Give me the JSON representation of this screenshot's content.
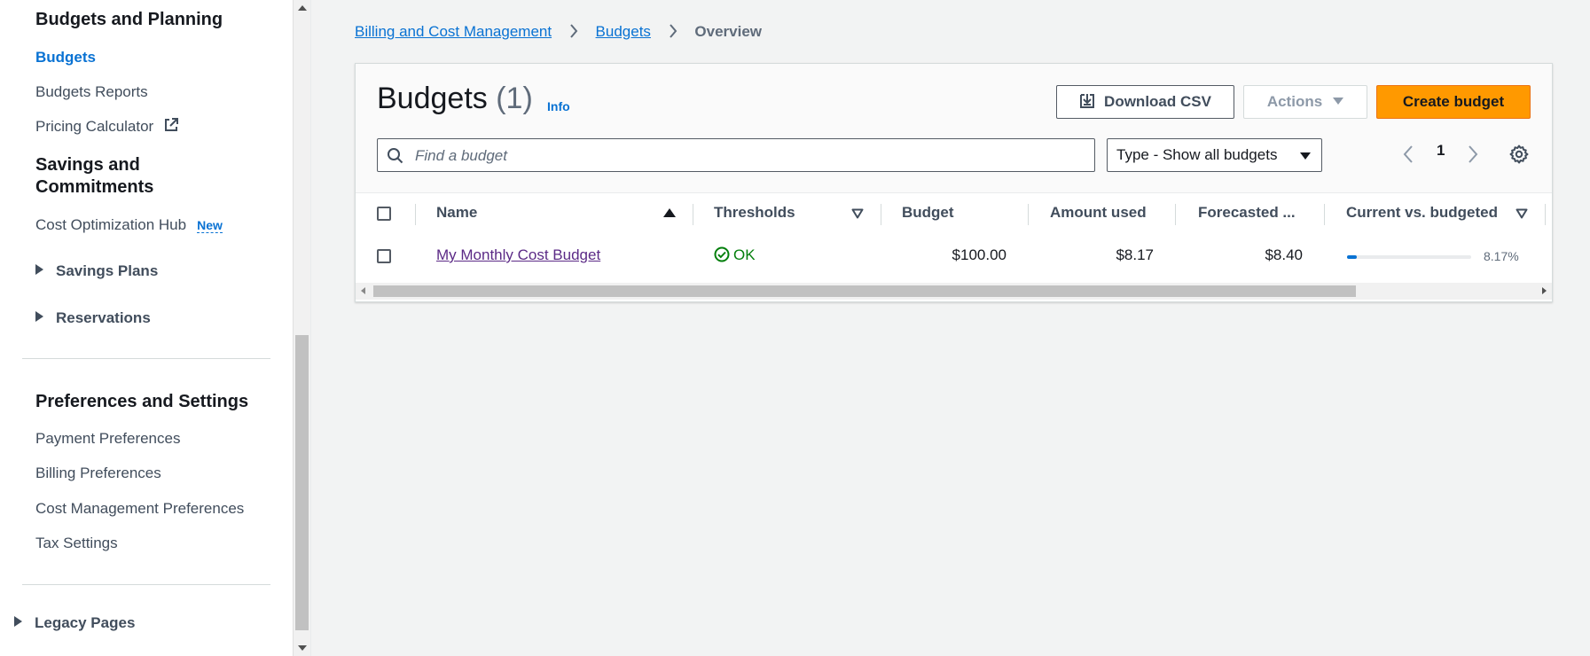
{
  "sidebar": {
    "section_budgets": "Budgets and Planning",
    "budgets": "Budgets",
    "budgets_reports": "Budgets Reports",
    "pricing_calculator": "Pricing Calculator",
    "section_savings_line1": "Savings and",
    "section_savings_line2": "Commitments",
    "cost_optimization_hub": "Cost Optimization Hub",
    "new_badge": "New",
    "savings_plans": "Savings Plans",
    "reservations": "Reservations",
    "section_preferences": "Preferences and Settings",
    "payment_preferences": "Payment Preferences",
    "billing_preferences": "Billing Preferences",
    "cost_management_preferences": "Cost Management Preferences",
    "tax_settings": "Tax Settings",
    "legacy_pages": "Legacy Pages"
  },
  "breadcrumb": {
    "root": "Billing and Cost Management",
    "budgets": "Budgets",
    "current": "Overview"
  },
  "panel": {
    "title": "Budgets",
    "count": "(1)",
    "info": "Info",
    "download_csv": "Download CSV",
    "actions": "Actions",
    "create_budget": "Create budget",
    "search_placeholder": "Find a budget",
    "search_value": "",
    "type_filter": "Type - Show all budgets",
    "page_number": "1"
  },
  "table": {
    "columns": {
      "name": "Name",
      "thresholds": "Thresholds",
      "budget": "Budget",
      "amount_used": "Amount used",
      "forecasted": "Forecasted ...",
      "current_vs_budgeted": "Current vs. budgeted"
    },
    "rows": [
      {
        "name": "My Monthly Cost Budget",
        "threshold_status": "OK",
        "budget": "$100.00",
        "amount_used": "$8.17",
        "forecasted": "$8.40",
        "current_vs_budgeted": "8.17%",
        "current_vs_budgeted_fraction": 0.0817
      }
    ]
  },
  "colors": {
    "link": "#0972d3",
    "primary_button": "#ff9900",
    "status_ok": "#037f0c",
    "visited_link": "#5b2a86"
  }
}
